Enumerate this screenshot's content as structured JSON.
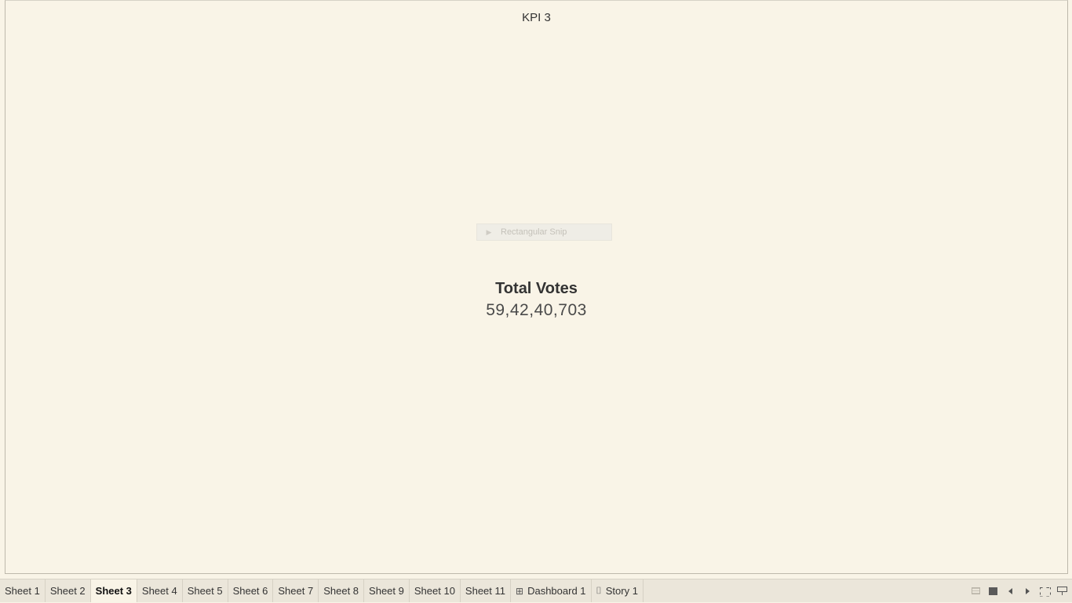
{
  "sheet": {
    "title": "KPI 3",
    "kpi": {
      "label": "Total Votes",
      "value": "59,42,40,703"
    }
  },
  "overlay": {
    "snip_label": "Rectangular Snip",
    "snip_icon": "▶"
  },
  "tabs": [
    {
      "label": "Sheet 1",
      "active": false
    },
    {
      "label": "Sheet 2",
      "active": false
    },
    {
      "label": "Sheet 3",
      "active": true
    },
    {
      "label": "Sheet 4",
      "active": false
    },
    {
      "label": "Sheet 5",
      "active": false
    },
    {
      "label": "Sheet 6",
      "active": false
    },
    {
      "label": "Sheet 7",
      "active": false
    },
    {
      "label": "Sheet 8",
      "active": false
    },
    {
      "label": "Sheet 9",
      "active": false
    },
    {
      "label": "Sheet 10",
      "active": false
    },
    {
      "label": "Sheet 11",
      "active": false
    },
    {
      "label": "Dashboard 1",
      "icon": "dashboard-icon",
      "icon_glyph": "⊞",
      "active": false
    },
    {
      "label": "Story 1",
      "icon": "story-icon",
      "icon_glyph": "⌷",
      "active": false
    }
  ],
  "controls": [
    "filmstrip-icon",
    "single-sheet-icon",
    "previous-icon",
    "next-icon",
    "fullscreen-icon",
    "presentation-icon"
  ],
  "colors": {
    "background": "#f9f4e7",
    "tabbar": "#ebe6da",
    "text": "#333333"
  }
}
